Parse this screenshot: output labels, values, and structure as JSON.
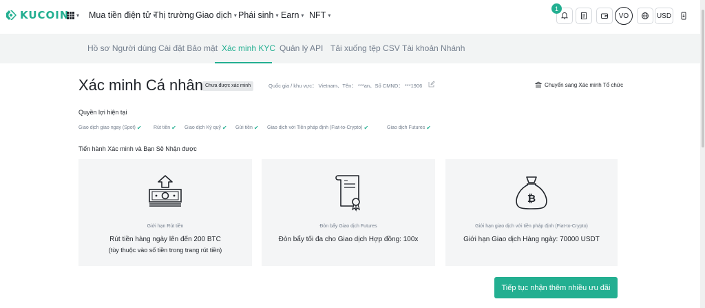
{
  "brand": {
    "name": "KUCOIN",
    "accent": "#23af91"
  },
  "nav": {
    "items": [
      {
        "label": "Mua tiền điện tử",
        "dropdown": true
      },
      {
        "label": "Thị trường",
        "dropdown": false
      },
      {
        "label": "Giao dịch",
        "dropdown": true
      },
      {
        "label": "Phái sinh",
        "dropdown": true
      },
      {
        "label": "Earn",
        "dropdown": true
      },
      {
        "label": "NFT",
        "dropdown": true
      }
    ],
    "notification_count": "1",
    "avatar_initials": "VO",
    "currency": "USD",
    "icons": [
      "bell-icon",
      "orders-icon",
      "wallet-icon",
      "globe-icon",
      "download-icon"
    ]
  },
  "subnav": {
    "tabs": [
      {
        "label": "Hồ sơ Người dùng"
      },
      {
        "label": "Cài đặt Bảo mật"
      },
      {
        "label": "Xác minh KYC",
        "active": true
      },
      {
        "label": "Quản lý API"
      },
      {
        "label": "Tải xuống tệp CSV"
      },
      {
        "label": "Tài khoản Nhánh"
      }
    ]
  },
  "kyc": {
    "title": "Xác minh Cá nhân",
    "status": "Chưa được xác minh",
    "info": "Quốc gia / khu vực： Vietnam、Tên： ***an、Số CMND： ***1906",
    "switch_label": "Chuyển sang Xác minh Tổ chức",
    "current_rights_title": "Quyền lợi hiện tại",
    "benefits": [
      "Giao dịch giao ngay (Spot)",
      "Rút tiền",
      "Giao dịch Ký quỹ",
      "Gửi tiền",
      "Giao dịch với Tiền pháp định (Fiat-to-Crypto)",
      "Giao dịch Futures"
    ],
    "upgrade_title": "Tiến hành Xác minh và Bạn Sẽ Nhận được",
    "cards": [
      {
        "icon": "withdraw-cash-icon",
        "caption": "Giới hạn Rút tiền",
        "heading": "Rút tiền hàng ngày lên đến 200 BTC",
        "note": "(tùy thuộc vào số tiền trong trang rút tiền)"
      },
      {
        "icon": "certificate-icon",
        "caption": "Đòn bẩy Giao dịch Futures",
        "heading": "Đòn bẩy tối đa cho Giao dịch Hợp đồng: 100x",
        "note": ""
      },
      {
        "icon": "bitcoin-bag-icon",
        "caption": "Giới hạn giao dịch với tiền pháp định (Fiat-to-Crypto)",
        "heading": "Giới hạn Giao dịch Hàng ngày: 70000 USDT",
        "note": ""
      }
    ],
    "cta_label": "Tiếp tục nhận thêm nhiều ưu đãi"
  }
}
